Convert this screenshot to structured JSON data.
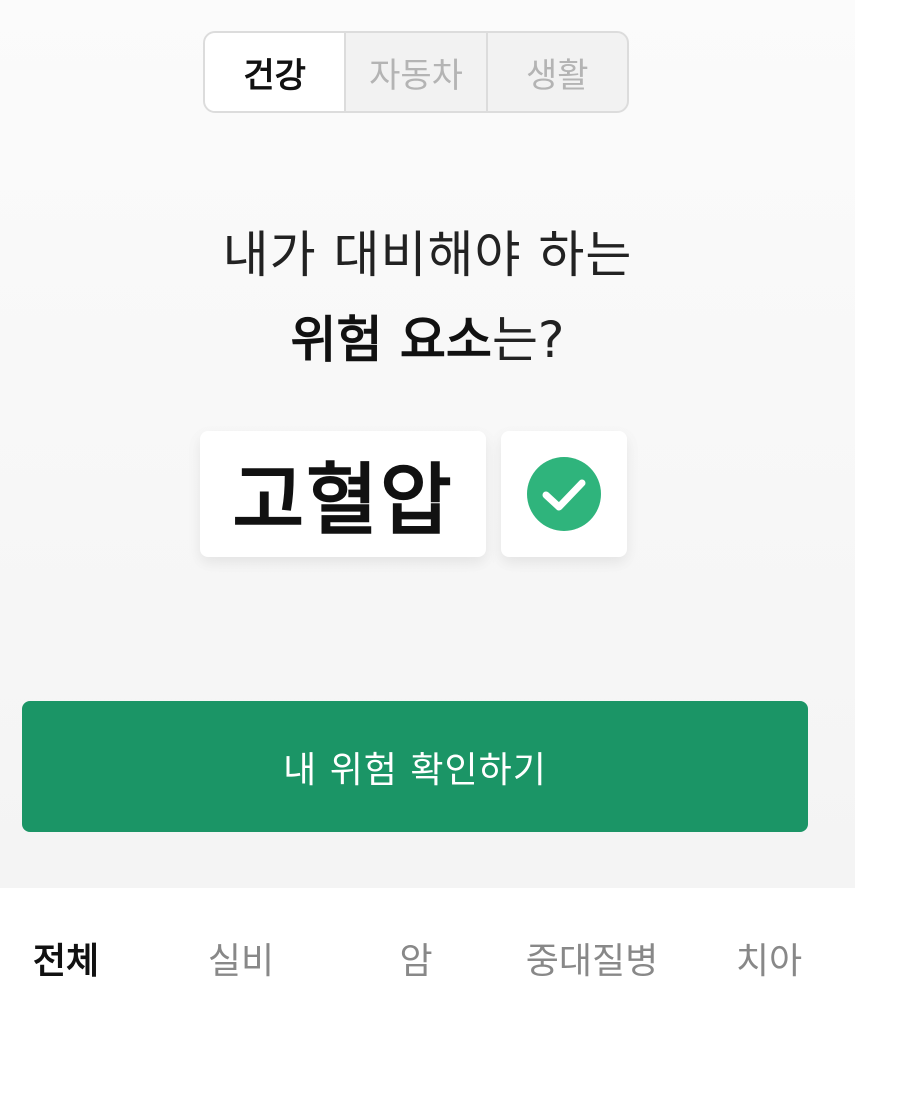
{
  "segments": [
    {
      "label": "건강",
      "selected": true
    },
    {
      "label": "자동차",
      "selected": false
    },
    {
      "label": "생활",
      "selected": false
    }
  ],
  "question": {
    "line1": "내가 대비해야 하는",
    "line2_bold": "위험 요소",
    "line2_rest": "는?"
  },
  "keyword": "고혈압",
  "check_icon": "check-circle-icon",
  "accent_color": "#1b9566",
  "cta_label": "내 위험 확인하기",
  "categories": [
    {
      "label": "전체",
      "active": true
    },
    {
      "label": "실비",
      "active": false
    },
    {
      "label": "암",
      "active": false
    },
    {
      "label": "중대질병",
      "active": false
    },
    {
      "label": "치아",
      "active": false
    }
  ]
}
